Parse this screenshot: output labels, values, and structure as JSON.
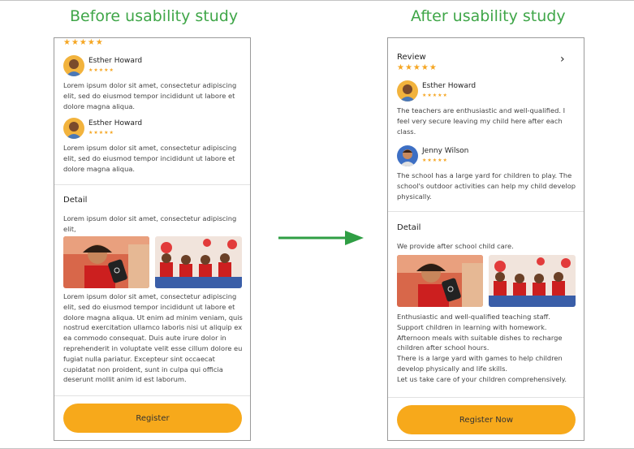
{
  "headings": {
    "before": "Before usability study",
    "after": "After usability study"
  },
  "colors": {
    "heading": "#3fa648",
    "button": "#f7a91b",
    "stars": "#f5a623",
    "arrow": "#2f9e44"
  },
  "icons": {
    "rating": "star-icon",
    "chevron": "chevron-right-icon",
    "arrow": "arrow-right-icon"
  },
  "before": {
    "top_stars": "★★★★★",
    "reviews": [
      {
        "name": "Esther Howard",
        "stars": "★★★★★",
        "text": "Lorem ipsum dolor sit amet, consectetur adipiscing elit, sed do eiusmod tempor incididunt ut labore et dolore magna aliqua."
      },
      {
        "name": "Esther Howard",
        "stars": "★★★★★",
        "text": "Lorem ipsum dolor sit amet, consectetur adipiscing elit, sed do eiusmod tempor incididunt ut labore et dolore magna aliqua."
      }
    ],
    "detail_title": "Detail",
    "detail_intro": "Lorem ipsum dolor sit amet, consectetur adipiscing elit,",
    "detail_body": "Lorem ipsum dolor sit amet, consectetur adipiscing elit, sed do eiusmod tempor incididunt ut labore et dolore magna aliqua. Ut enim ad minim veniam, quis nostrud exercitation ullamco laboris nisi ut aliquip ex ea commodo consequat. Duis aute irure dolor in reprehenderit in voluptate velit esse cillum dolore eu fugiat nulla pariatur. Excepteur sint occaecat cupidatat non proident, sunt in culpa qui officia deserunt mollit anim id est laborum.",
    "button": "Register"
  },
  "after": {
    "review_title": "Review",
    "review_stars": "★★★★★",
    "reviews": [
      {
        "name": "Esther Howard",
        "stars": "★★★★★",
        "text": "The teachers are enthusiastic and well-qualified. I feel very secure leaving my child here after each class."
      },
      {
        "name": "Jenny Wilson",
        "stars": "★★★★★",
        "text": "The school has a large yard for children to play. The school's outdoor activities can help my child develop physically."
      }
    ],
    "detail_title": "Detail",
    "detail_intro": "We provide after school child care.",
    "detail_lines": [
      "Enthusiastic and well-qualified teaching staff.",
      "Support children in learning with homework.",
      "Afternoon meals with suitable dishes to recharge children after school hours.",
      "There is a large yard with games to help children develop physically and life skills.",
      "Let us take care of your children comprehensively."
    ],
    "button": "Register Now"
  }
}
